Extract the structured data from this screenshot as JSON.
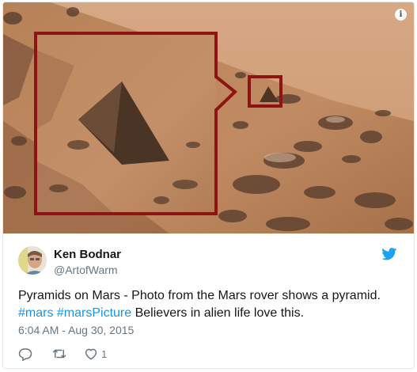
{
  "media": {
    "icons": {
      "info": "info-icon"
    },
    "info_label": "i",
    "colors": {
      "annotation": "#8e1414",
      "sky": "#d3a27a",
      "ground": "#b07a50"
    }
  },
  "tweet": {
    "author_name": "Ken Bodnar",
    "author_handle": "@ArtofWarm",
    "text_line1": "Pyramids on Mars - Photo from the Mars rover shows a pyramid.",
    "hashtag1": "#mars",
    "hashtag2": "#marsPicture",
    "text_line2_rest": "Believers in alien life love this.",
    "timestamp": "6:04 AM - Aug 30, 2015",
    "like_count": "1"
  },
  "icons": {
    "brand": "twitter-bird-icon",
    "reply": "reply-icon",
    "retweet": "retweet-icon",
    "like": "heart-icon"
  },
  "colors": {
    "link": "#1b95e0",
    "secondary": "#657786",
    "text": "#14171a",
    "brand": "#1da1f2"
  }
}
